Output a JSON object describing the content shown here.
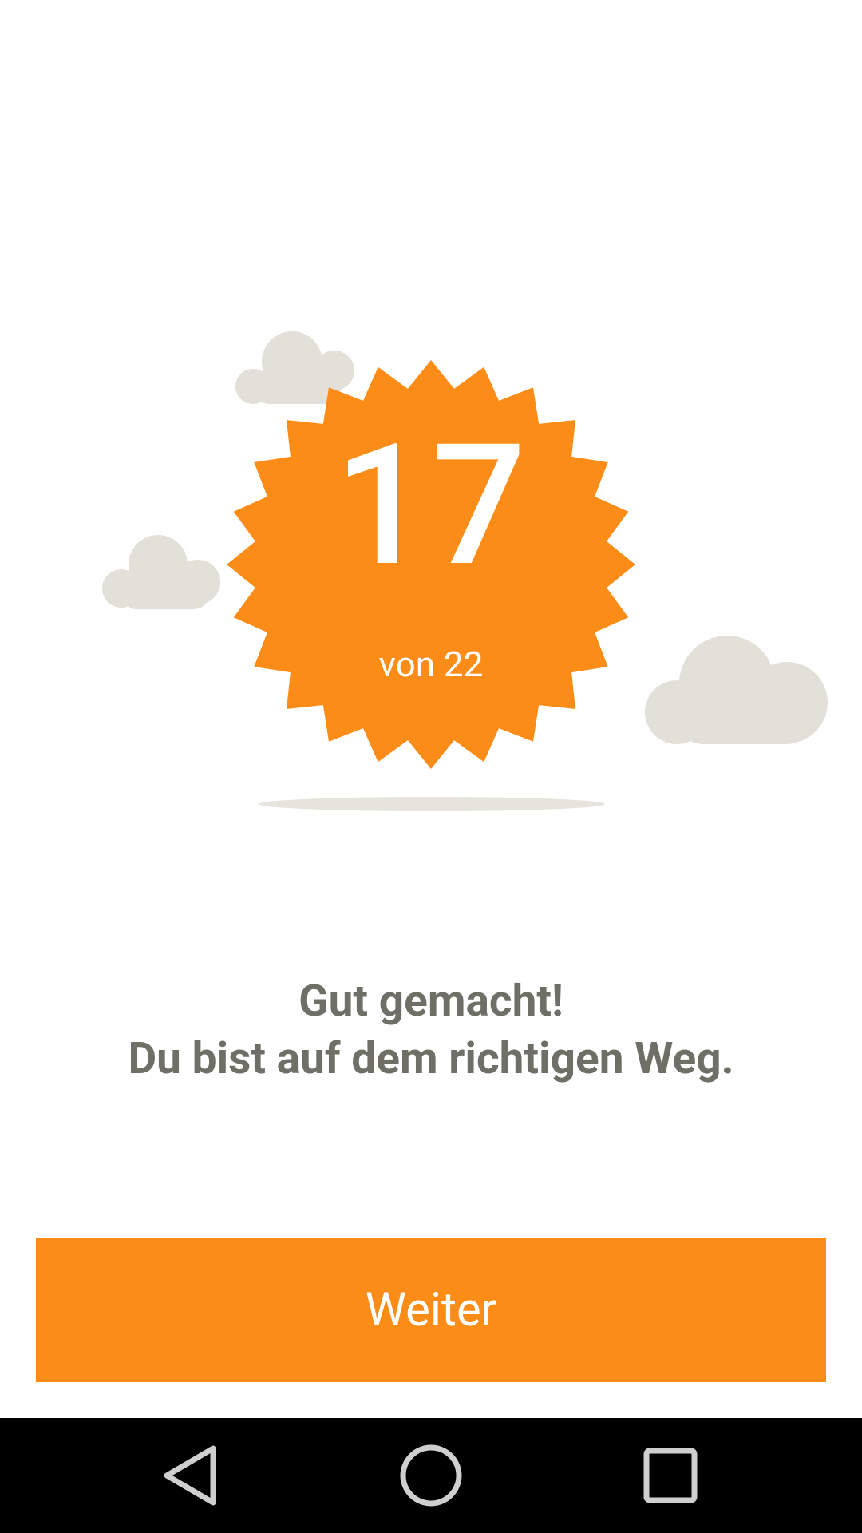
{
  "badge": {
    "score": "17",
    "subtitle": "von 22",
    "color": "#fb8c18"
  },
  "message": {
    "line1": "Gut gemacht!",
    "line2": "Du bist auf dem richtigen Weg."
  },
  "continue_button": {
    "label": "Weiter",
    "color": "#fb8c18"
  },
  "colors": {
    "cloud": "#e2e0d8",
    "text": "#6f6f67",
    "navbar": "#000000"
  },
  "navbar": {
    "buttons": [
      "back-icon",
      "home-icon",
      "recents-icon"
    ]
  }
}
